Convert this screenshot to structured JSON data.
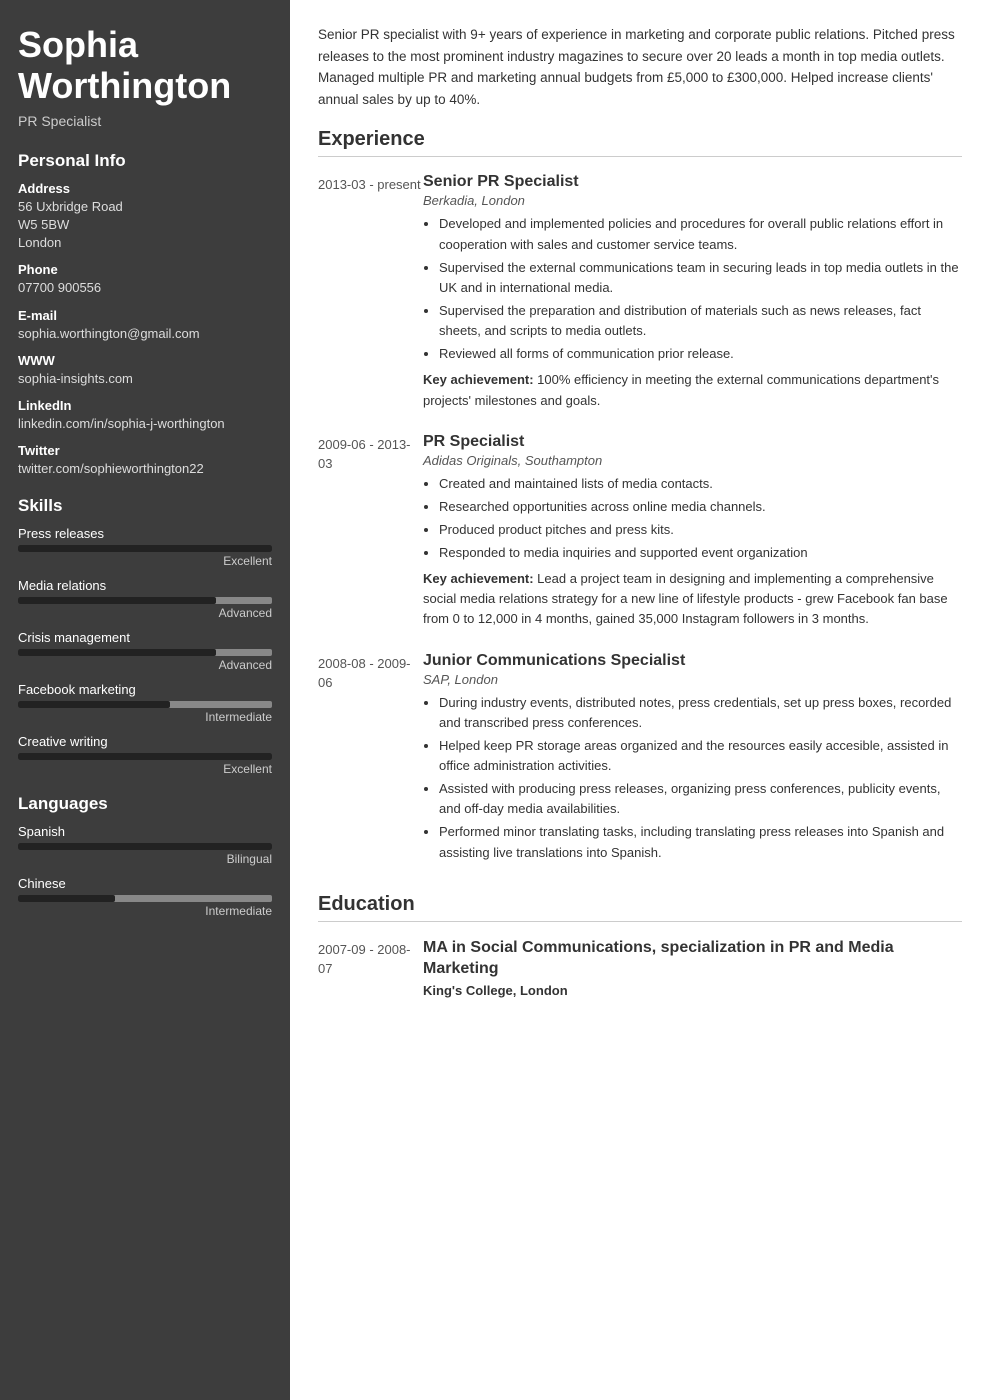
{
  "sidebar": {
    "name": "Sophia Worthington",
    "job_title": "PR Specialist",
    "personal_info_label": "Personal Info",
    "address_label": "Address",
    "address_lines": [
      "56 Uxbridge Road",
      "W5 5BW",
      "London"
    ],
    "phone_label": "Phone",
    "phone_value": "07700 900556",
    "email_label": "E-mail",
    "email_value": "sophia.worthington@gmail.com",
    "www_label": "WWW",
    "www_value": "sophia-insights.com",
    "linkedin_label": "LinkedIn",
    "linkedin_value": "linkedin.com/in/sophia-j-worthington",
    "twitter_label": "Twitter",
    "twitter_value": "twitter.com/sophieworthington22",
    "skills_label": "Skills",
    "skills": [
      {
        "name": "Press releases",
        "level": "Excellent",
        "fill_pct": 100,
        "marker_pct": 100
      },
      {
        "name": "Media relations",
        "level": "Advanced",
        "fill_pct": 78,
        "marker_pct": 78
      },
      {
        "name": "Crisis management",
        "level": "Advanced",
        "fill_pct": 78,
        "marker_pct": 78
      },
      {
        "name": "Facebook marketing",
        "level": "Intermediate",
        "fill_pct": 60,
        "marker_pct": 60
      },
      {
        "name": "Creative writing",
        "level": "Excellent",
        "fill_pct": 100,
        "marker_pct": 100
      }
    ],
    "languages_label": "Languages",
    "languages": [
      {
        "name": "Spanish",
        "level": "Bilingual",
        "fill_pct": 100
      },
      {
        "name": "Chinese",
        "level": "Intermediate",
        "fill_pct": 38
      }
    ]
  },
  "main": {
    "summary": "Senior PR specialist with 9+ years of experience in marketing and corporate public relations. Pitched press releases to the most prominent industry magazines to secure over 20 leads a month in top media outlets. Managed multiple PR and marketing annual budgets from £5,000 to £300,000. Helped increase clients' annual sales by up to 40%.",
    "experience_label": "Experience",
    "experiences": [
      {
        "date": "2013-03 - present",
        "title": "Senior PR Specialist",
        "company": "Berkadia, London",
        "bullets": [
          "Developed and implemented policies and procedures for overall public relations effort in cooperation with sales and customer service teams.",
          "Supervised the external communications team in securing leads in top media outlets in the UK and in international media.",
          "Supervised the preparation and distribution of materials such as news releases, fact sheets, and scripts to media outlets.",
          "Reviewed all forms of communication prior release."
        ],
        "achievement": "Key achievement: 100% efficiency in meeting the external communications department's projects' milestones and goals."
      },
      {
        "date": "2009-06 - 2013-03",
        "title": "PR Specialist",
        "company": "Adidas Originals, Southampton",
        "bullets": [
          "Created and maintained lists of media contacts.",
          "Researched opportunities across online media channels.",
          "Produced product pitches and press kits.",
          "Responded to media inquiries and supported event organization"
        ],
        "achievement": "Key achievement: Lead a project team in designing and implementing a comprehensive social media relations strategy for a new line of lifestyle products - grew Facebook fan base from 0 to 12,000 in 4 months, gained 35,000 Instagram followers in 3 months."
      },
      {
        "date": "2008-08 - 2009-06",
        "title": "Junior Communications Specialist",
        "company": "SAP, London",
        "bullets": [
          "During industry events, distributed notes, press credentials, set up press boxes, recorded and transcribed press conferences.",
          "Helped keep PR storage areas organized and the resources easily accesible, assisted in office administration activities.",
          "Assisted with producing press releases, organizing press conferences, publicity events, and off-day media availabilities.",
          "Performed minor translating tasks, including translating press releases into Spanish and assisting live translations into Spanish."
        ],
        "achievement": ""
      }
    ],
    "education_label": "Education",
    "education": [
      {
        "date": "2007-09 - 2008-07",
        "degree": "MA in Social Communications, specialization in PR and Media Marketing",
        "school": "King's College, London"
      }
    ]
  }
}
